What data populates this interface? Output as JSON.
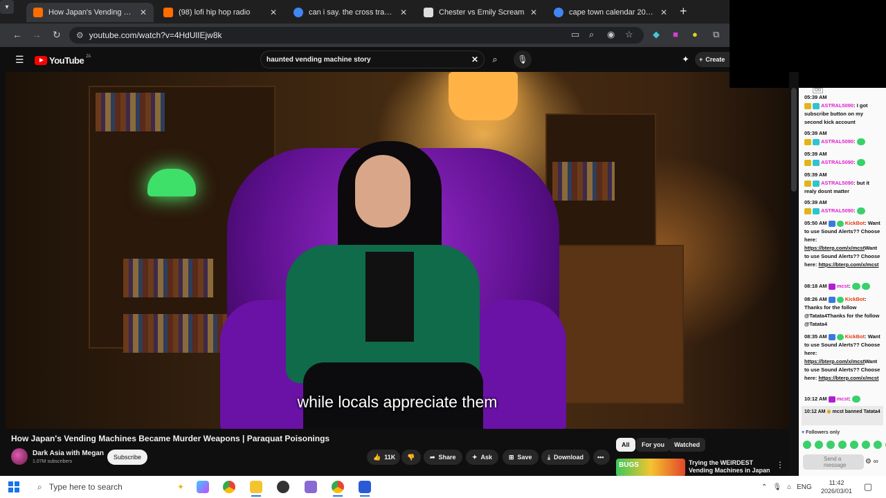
{
  "browser": {
    "tabs": [
      {
        "title": "How Japan's Vending Mac",
        "favicon_color": "#ff6d00",
        "active": true
      },
      {
        "title": "(98) lofi hip hop radio",
        "favicon_color": "#ff6d00",
        "active": false
      },
      {
        "title": "can i say. the cross transference",
        "favicon_color": "#4285f4",
        "active": false
      },
      {
        "title": "Chester vs Emily Scream",
        "favicon_color": "#dddddd",
        "active": false
      },
      {
        "title": "cape town calendar 2026 febru",
        "favicon_color": "#4285f4",
        "active": false
      }
    ],
    "url": "youtube.com/watch?v=4HdUlIEjw8k"
  },
  "youtube": {
    "logo_text": "YouTube",
    "logo_region": "ZA",
    "search_value": "haunted vending machine story",
    "create_label": "Create",
    "subtitle": "while locals appreciate them",
    "video_title": "How Japan's Vending Machines Became Murder Weapons | Paraquat Poisonings",
    "channel_name": "Dark Asia with Megan",
    "subscribers": "1.07M subscribers",
    "subscribe_label": "Subscribe",
    "actions": {
      "likes": "11K",
      "share": "Share",
      "ask": "Ask",
      "save": "Save",
      "download": "Download"
    },
    "chips": [
      "All",
      "For you",
      "Watched"
    ],
    "recommendation": {
      "thumb_text": "BUGS",
      "title": "Trying the WEIRDEST Vending Machines in Japan"
    }
  },
  "chat": {
    "og_tag": "OG",
    "messages": [
      {
        "time": "05:39 AM",
        "user": "ASTRAL5090",
        "text": "I got subscribe button on my second kick account"
      },
      {
        "time": "05:39 AM",
        "user": "ASTRAL5090",
        "text": ""
      },
      {
        "time": "05:39 AM",
        "user": "ASTRAL5090",
        "text": ""
      },
      {
        "time": "05:39 AM",
        "user": "ASTRAL5090",
        "text": "but it realy dosnt matter"
      },
      {
        "time": "05:39 AM",
        "user": "ASTRAL5090",
        "text": ""
      },
      {
        "time": "05:50 AM",
        "user": "KickBot",
        "text": "Want to use Sound Alerts?? Choose here: ",
        "link": "https://bterp.com/x/mcst",
        "text2": "Want to use Sound Alerts?? Choose here: ",
        "link2": "https://bterp.com/x/mcst"
      },
      {
        "time": "08:18 AM",
        "user": "mcst",
        "text": ""
      },
      {
        "time": "08:26 AM",
        "user": "KickBot",
        "text": "Thanks for the follow @Tatata4Thanks for the follow @Tatata4"
      },
      {
        "time": "08:35 AM",
        "user": "KickBot",
        "text": "Want to use Sound Alerts?? Choose here: ",
        "link": "https://bterp.com/x/mcst",
        "text2": "Want to use Sound Alerts?? Choose here: ",
        "link2": "https://bterp.com/x/mcst"
      },
      {
        "time": "10:12 AM",
        "user": "mcst",
        "text": ""
      }
    ],
    "ban_time": "10:12 AM",
    "ban_text": "mcst banned Tatata4",
    "followers_only": "Followers only",
    "send_placeholder": "Send a message"
  },
  "taskbar": {
    "search_placeholder": "Type here to search",
    "language": "ENG",
    "time": "11:42",
    "date": "2026/03/01"
  },
  "colors": {
    "accent_red": "#ff0000",
    "kick_green": "#3ad06a",
    "chat_user": "#e01fd0"
  }
}
